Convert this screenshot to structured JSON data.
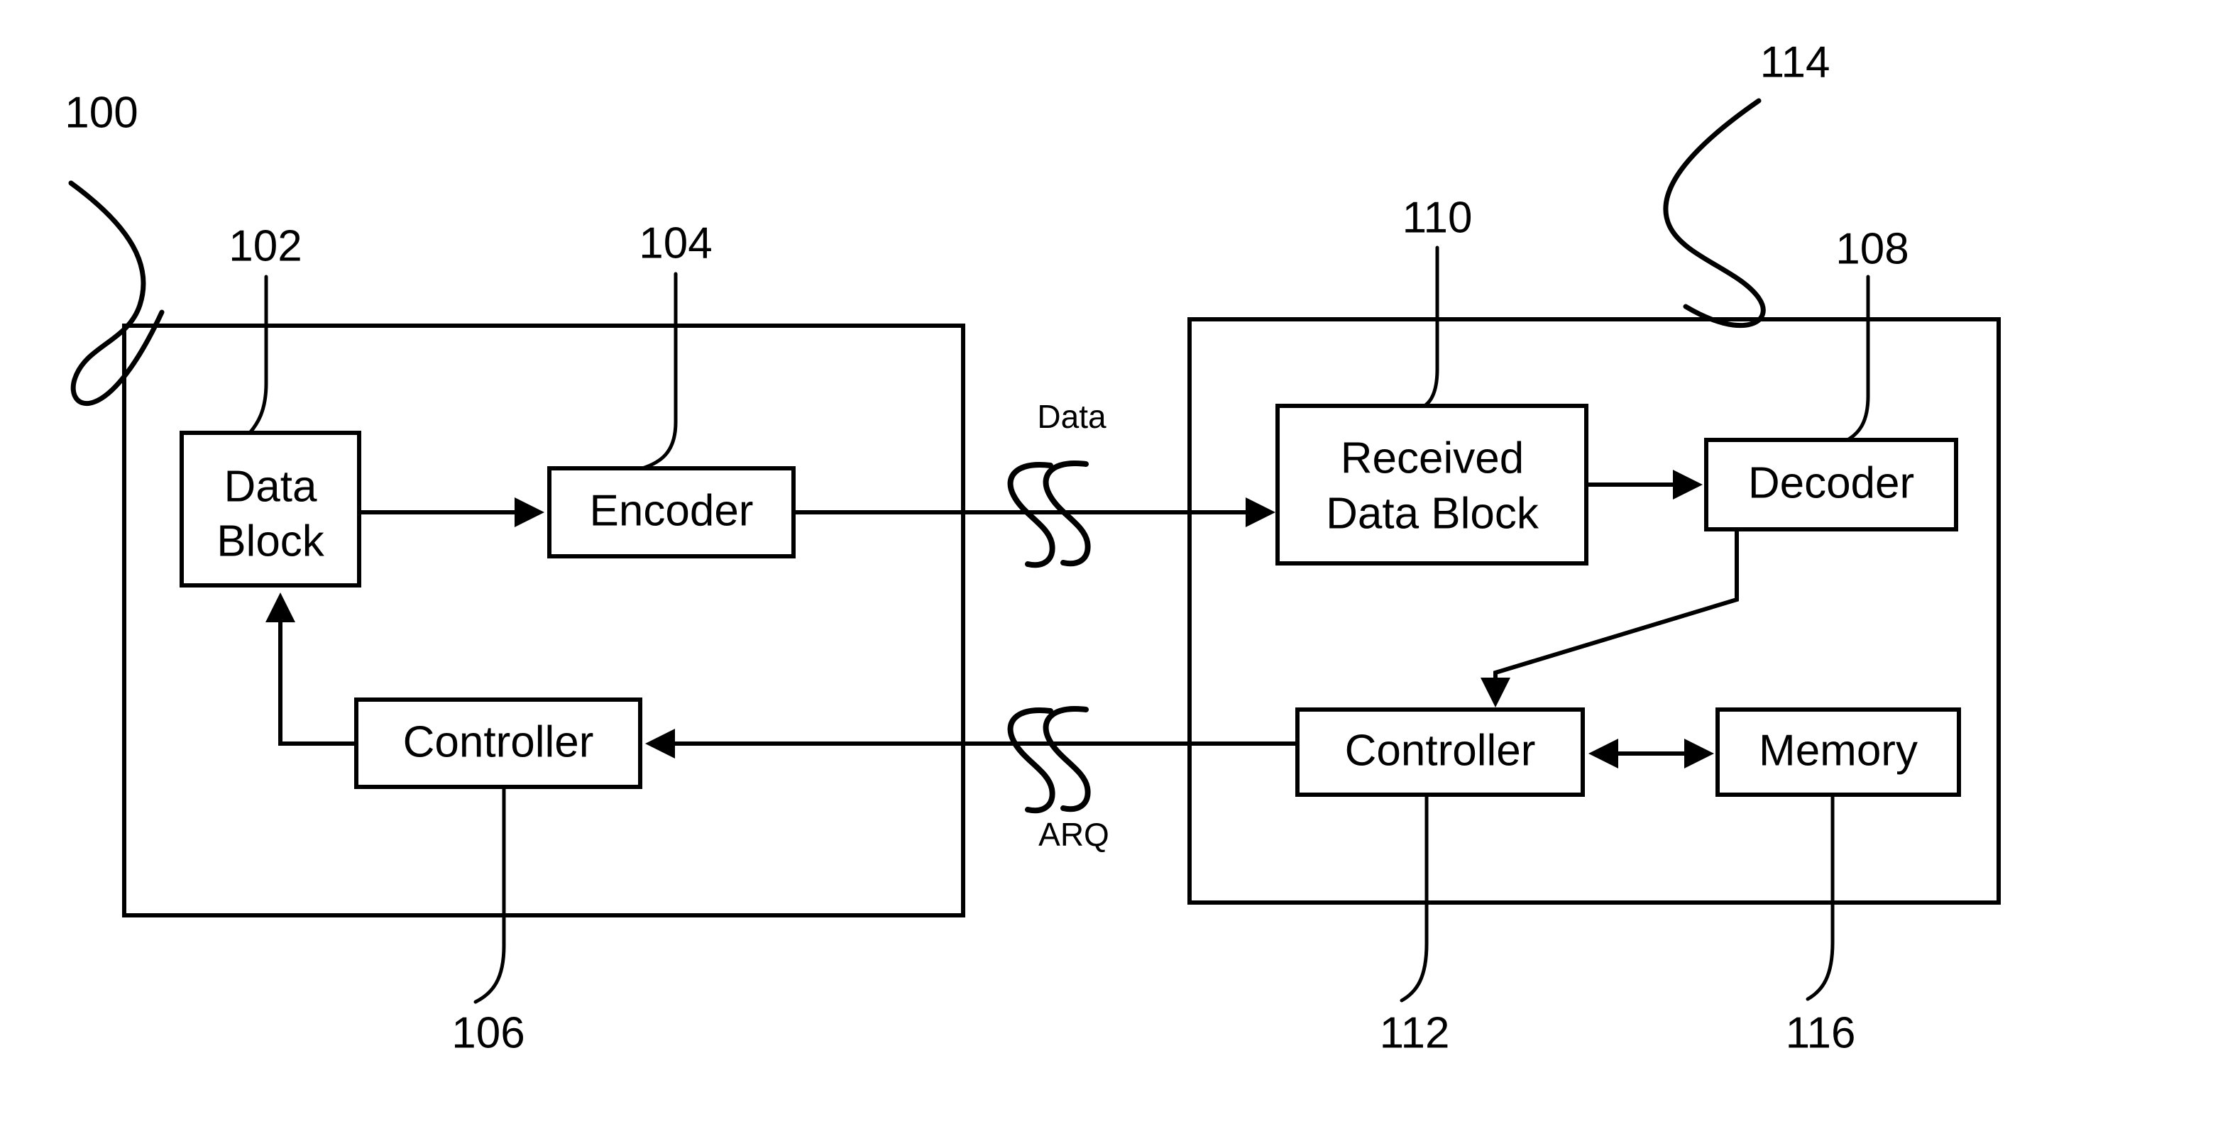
{
  "figure": {
    "name": "hybrid-arq-communication-system-block-diagram",
    "background_color": "#ffffff",
    "line_color": "#000000"
  },
  "containers": [
    {
      "id": "transmitter",
      "ref": "100",
      "label": ""
    },
    {
      "id": "receiver",
      "ref": "114",
      "label": ""
    }
  ],
  "boxes": {
    "data_block": {
      "line1": "Data",
      "line2": "Block",
      "ref": "102"
    },
    "encoder": {
      "line1": "Encoder",
      "line2": "",
      "ref": "104"
    },
    "tx_controller": {
      "line1": "Controller",
      "line2": "",
      "ref": "106"
    },
    "received_data_block": {
      "line1": "Received",
      "line2": "Data Block",
      "ref": "110"
    },
    "decoder": {
      "line1": "Decoder",
      "line2": "",
      "ref": "108"
    },
    "rx_controller": {
      "line1": "Controller",
      "line2": "",
      "ref": "112"
    },
    "memory": {
      "line1": "Memory",
      "line2": "",
      "ref": "116"
    }
  },
  "signals": {
    "data": "Data",
    "arq": "ARQ"
  },
  "reference_numerals": {
    "system": "100",
    "data_block": "102",
    "encoder": "104",
    "tx_controller": "106",
    "decoder": "108",
    "received_data_block": "110",
    "rx_controller": "112",
    "receiver": "114",
    "memory": "116"
  }
}
